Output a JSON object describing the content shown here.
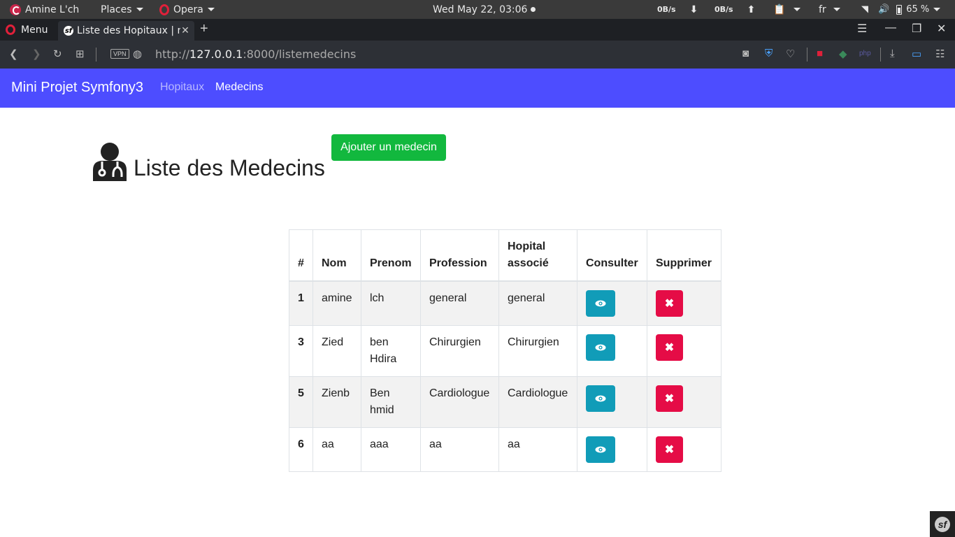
{
  "system": {
    "user": "Amine L'ch",
    "places": "Places",
    "app": "Opera",
    "clock": "Wed May 22, 03:06",
    "down_rate": "0B/s",
    "up_rate": "0B/s",
    "lang": "fr",
    "battery": "65 %"
  },
  "browser": {
    "menu_label": "Menu",
    "tab_title": "Liste des Hopitaux | m",
    "url_scheme": "http://",
    "url_host": "127.0.0.1",
    "url_path": ":8000/listemedecins",
    "vpn": "VPN"
  },
  "navbar": {
    "brand": "Mini Projet Symfony3",
    "links": [
      "Hopitaux",
      "Medecins"
    ]
  },
  "page": {
    "title": "Liste des Medecins",
    "add_button": "Ajouter un medecin"
  },
  "table": {
    "headers": [
      "#",
      "Nom",
      "Prenom",
      "Profession",
      "Hopital associé",
      "Consulter",
      "Supprimer"
    ],
    "rows": [
      {
        "id": "1",
        "nom": "amine",
        "prenom": "lch",
        "profession": "general",
        "hopital": "general"
      },
      {
        "id": "3",
        "nom": "Zied",
        "prenom": "ben Hdira",
        "profession": "Chirurgien",
        "hopital": "Chirurgien"
      },
      {
        "id": "5",
        "nom": "Zienb",
        "prenom": "Ben hmid",
        "profession": "Cardiologue",
        "hopital": "Cardiologue"
      },
      {
        "id": "6",
        "nom": "aa",
        "prenom": "aaa",
        "profession": "aa",
        "hopital": "aa"
      }
    ],
    "delete_glyph": "✖"
  },
  "colors": {
    "navbar": "#4d4dff",
    "add_button": "#12b83e",
    "view_button": "#119cb8",
    "delete_button": "#e50c46"
  }
}
